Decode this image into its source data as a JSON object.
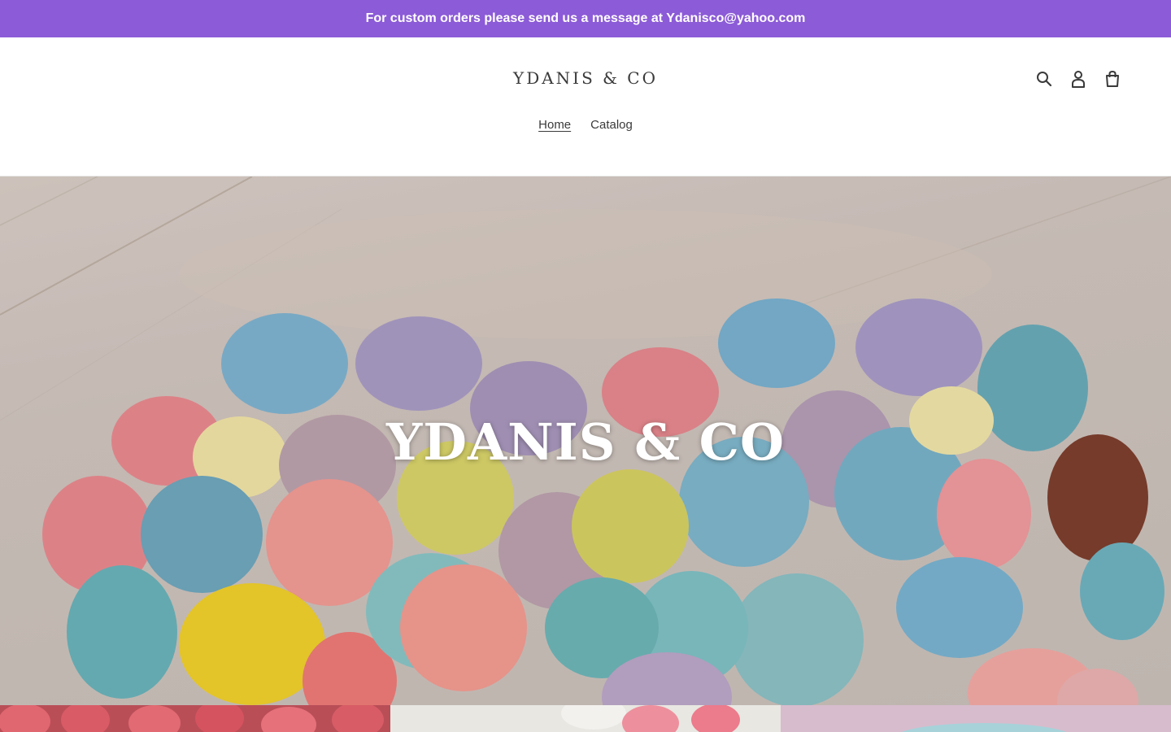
{
  "announcement": {
    "text": "For custom orders please send us a message at Ydanisco@yahoo.com",
    "background": "#8c5bd7"
  },
  "header": {
    "logo": "YDANIS & CO",
    "icons": [
      "search-icon",
      "account-icon",
      "cart-icon"
    ]
  },
  "nav": {
    "items": [
      {
        "label": "Home",
        "active": true
      },
      {
        "label": "Catalog",
        "active": false
      }
    ]
  },
  "hero": {
    "title": "YDANIS & CO",
    "image": "pastel macarons on white wood table"
  },
  "collections": [
    "pink-sugared-macarons",
    "pink-macarons",
    "blue-dessert"
  ]
}
